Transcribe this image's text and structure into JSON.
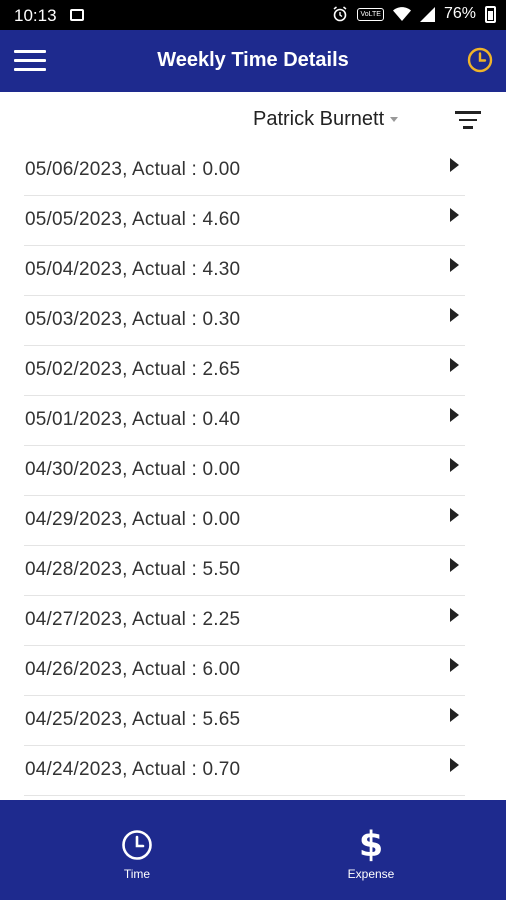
{
  "status_bar": {
    "time": "10:13",
    "network_badge": "VoLTE",
    "battery": "76%"
  },
  "app_bar": {
    "title": "Weekly Time Details"
  },
  "filter": {
    "user_name": "Patrick Burnett"
  },
  "entries": [
    {
      "label": "05/06/2023, Actual : 0.00"
    },
    {
      "label": "05/05/2023, Actual : 4.60"
    },
    {
      "label": "05/04/2023, Actual : 4.30"
    },
    {
      "label": "05/03/2023, Actual : 0.30"
    },
    {
      "label": "05/02/2023, Actual : 2.65"
    },
    {
      "label": "05/01/2023, Actual : 0.40"
    },
    {
      "label": "04/30/2023, Actual : 0.00"
    },
    {
      "label": "04/29/2023, Actual : 0.00"
    },
    {
      "label": "04/28/2023, Actual : 5.50"
    },
    {
      "label": "04/27/2023, Actual : 2.25"
    },
    {
      "label": "04/26/2023, Actual : 6.00"
    },
    {
      "label": "04/25/2023, Actual : 5.65"
    },
    {
      "label": "04/24/2023, Actual : 0.70"
    }
  ],
  "bottom_nav": {
    "time_label": "Time",
    "expense_label": "Expense",
    "expense_glyph": "$"
  },
  "colors": {
    "primary": "#1e2a8e",
    "clock_accent": "#f0b429"
  },
  "icons": [
    "menu-icon",
    "clock-icon",
    "filter-icon",
    "chevron-right-icon",
    "dollar-icon"
  ]
}
